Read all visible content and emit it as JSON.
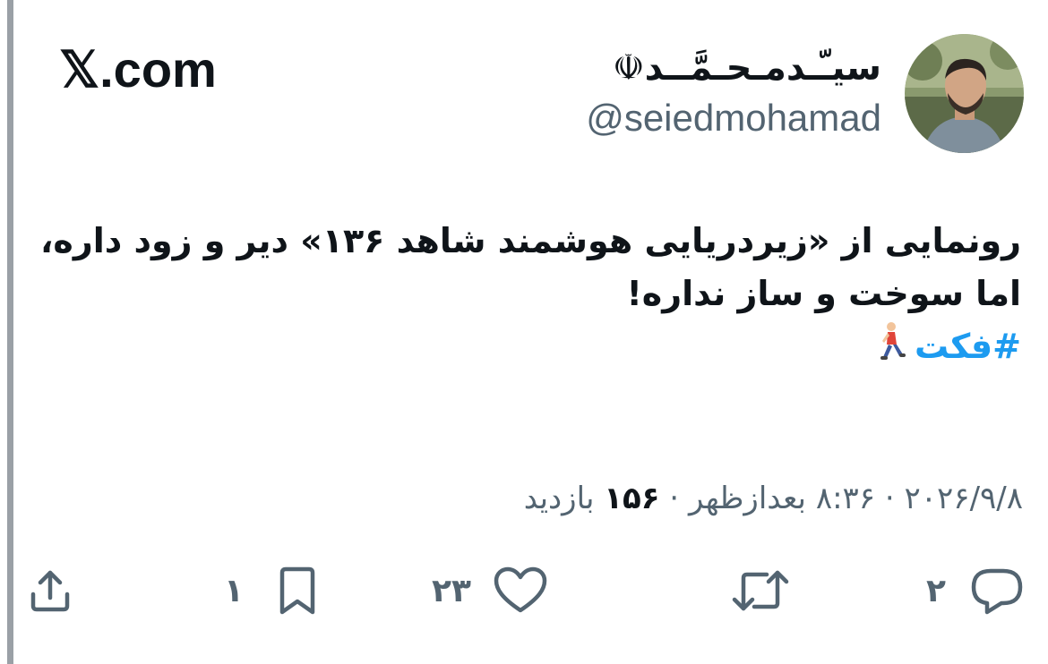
{
  "brand": "𝕏.com",
  "author": {
    "display_name": "سیـّـدمـحـمَّــد☫",
    "handle": "@seiedmohamad"
  },
  "tweet": {
    "line1": "رونمایی از «زیردریایی هوشمند شاهد ۱۳۶» دیر و زود داره،",
    "line2": "اما سوخت و ساز نداره!",
    "hashtag": "#فکت",
    "emoji": "person-walking"
  },
  "meta": {
    "date": "۲۰۲۶/۹/۸",
    "time": "۸:۳۶ بعدازظهر",
    "views_count": "۱۵۶",
    "views_label": "بازدید"
  },
  "actions": {
    "reply_count": "۲",
    "retweet_count": "",
    "like_count": "۲۳",
    "bookmark_count": "۱"
  },
  "colors": {
    "text": "#0f1419",
    "muted": "#536471",
    "link": "#1d9bf0",
    "left_bar": "#9aa0a6"
  }
}
